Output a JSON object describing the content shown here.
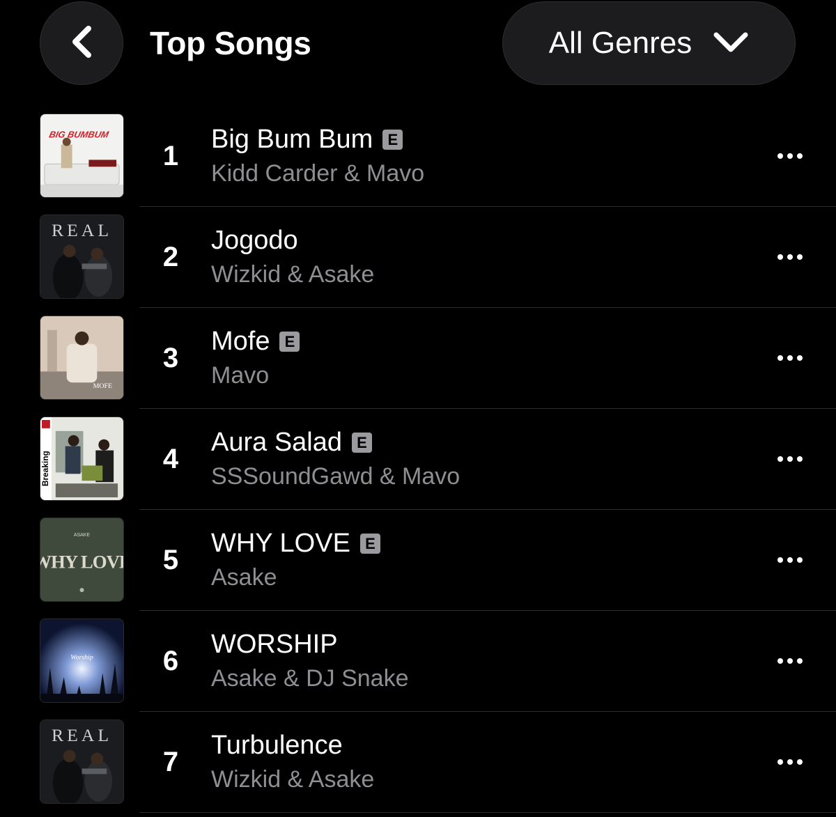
{
  "header": {
    "title": "Top Songs",
    "genre_filter": "All Genres"
  },
  "songs": [
    {
      "rank": "1",
      "title": "Big Bum Bum",
      "artist": "Kidd Carder & Mavo",
      "explicit": true,
      "explicit_label": "E",
      "artwork": "big-bum-bum-artwork",
      "art_text": "BIG BUMBUM"
    },
    {
      "rank": "2",
      "title": "Jogodo",
      "artist": "Wizkid & Asake",
      "explicit": false,
      "artwork": "real-artwork",
      "art_text": "REAL"
    },
    {
      "rank": "3",
      "title": "Mofe",
      "artist": "Mavo",
      "explicit": true,
      "explicit_label": "E",
      "artwork": "mofe-artwork",
      "art_text": "MOFE"
    },
    {
      "rank": "4",
      "title": "Aura Salad",
      "artist": "SSSoundGawd & Mavo",
      "explicit": true,
      "explicit_label": "E",
      "artwork": "aura-salad-artwork",
      "art_text": "Breaking"
    },
    {
      "rank": "5",
      "title": "WHY LOVE",
      "artist": "Asake",
      "explicit": true,
      "explicit_label": "E",
      "artwork": "why-love-artwork",
      "art_text": "WHY LOVE"
    },
    {
      "rank": "6",
      "title": "WORSHIP",
      "artist": "Asake & DJ Snake",
      "explicit": false,
      "artwork": "worship-artwork",
      "art_text": "Worship"
    },
    {
      "rank": "7",
      "title": "Turbulence",
      "artist": "Wizkid & Asake",
      "explicit": false,
      "artwork": "real-artwork",
      "art_text": "REAL"
    }
  ],
  "colors": {
    "background": "#000000",
    "button_bg": "#1c1c1e",
    "secondary_text": "#8e8e93",
    "separator": "#2c2c2e",
    "explicit_badge": "#9a9a9f"
  },
  "icons": {
    "back": "chevron-left-icon",
    "genre": "chevron-down-icon",
    "more": "ellipsis-icon"
  }
}
